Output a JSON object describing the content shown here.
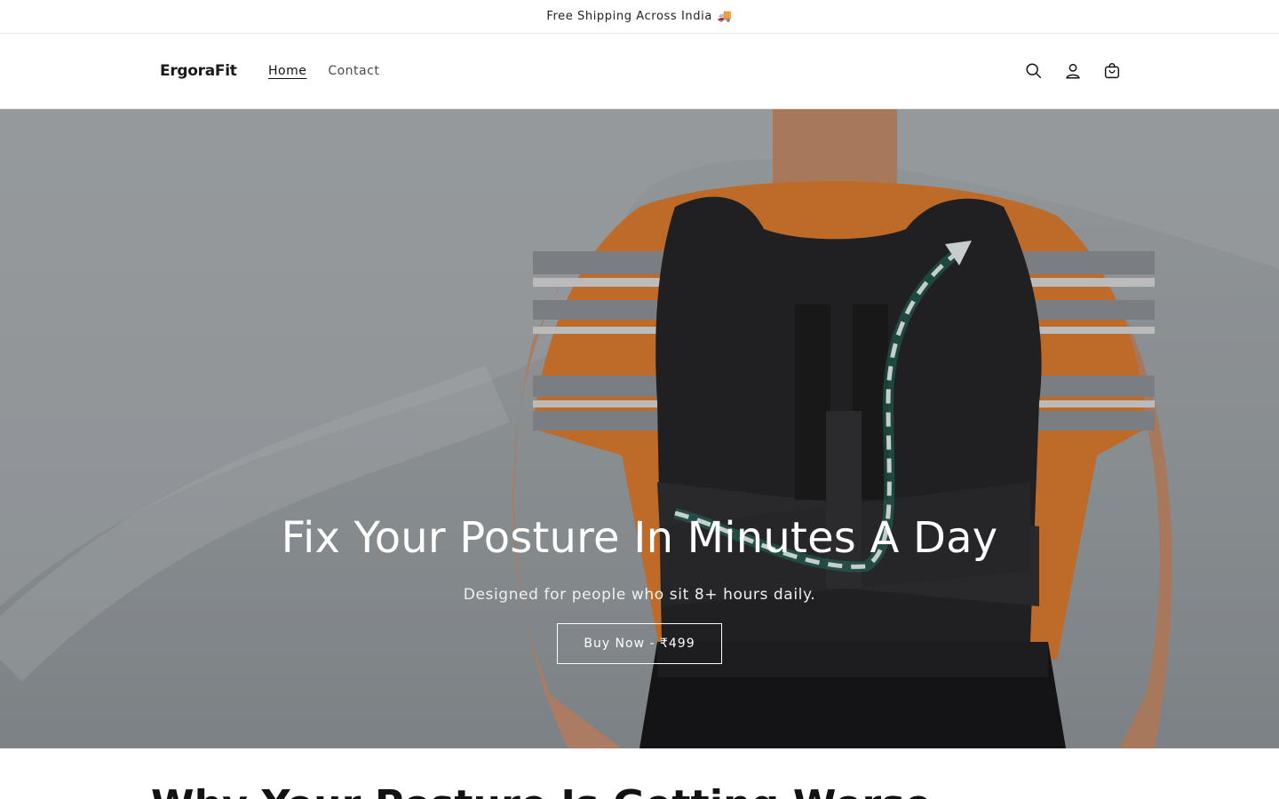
{
  "announcement": {
    "text": "Free Shipping Across India",
    "icon": "truck-icon",
    "emoji": "🚚"
  },
  "header": {
    "logo": "ErgoraFit",
    "nav": [
      {
        "label": "Home",
        "active": true
      },
      {
        "label": "Contact",
        "active": false
      }
    ],
    "icons": [
      "search-icon",
      "account-icon",
      "cart-icon"
    ]
  },
  "hero": {
    "title": "Fix Your Posture In Minutes A Day",
    "subtitle": "Designed for people who sit 8+ hours daily.",
    "button_label": "Buy Now - ₹499"
  },
  "section": {
    "heading": "Why Your Posture Is Getting Worse"
  },
  "colors": {
    "accent": "#121212",
    "background": "#ffffff",
    "hero_text": "#ffffff",
    "shirt_orange": "#e07a2a",
    "arrow_green": "#18a887"
  }
}
